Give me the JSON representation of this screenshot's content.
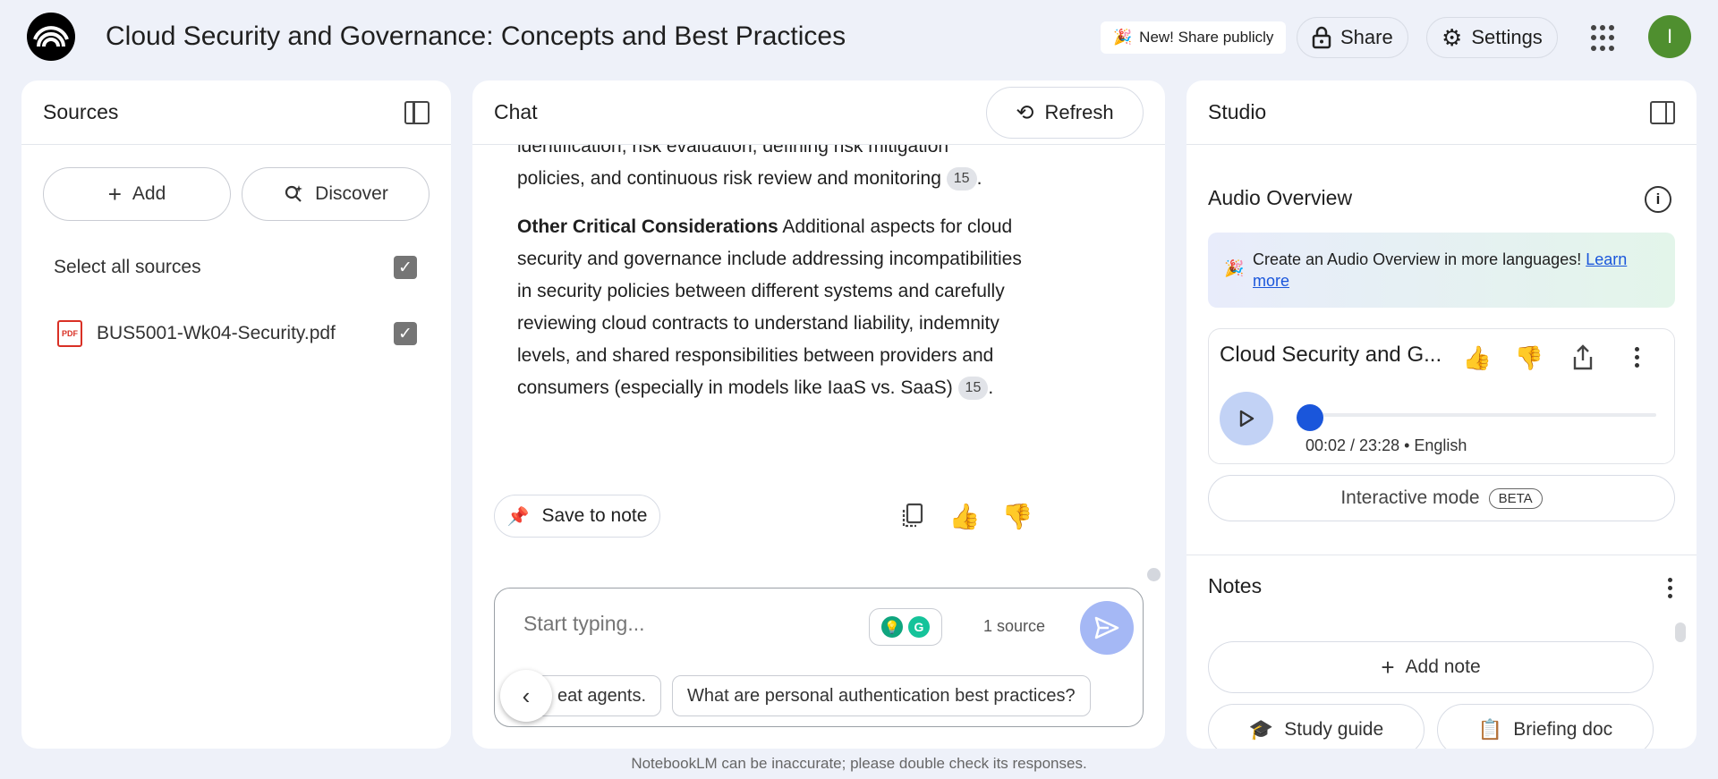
{
  "header": {
    "title": "Cloud Security and Governance: Concepts and Best Practices",
    "new_share_label": "New! Share publicly",
    "share_label": "Share",
    "settings_label": "Settings",
    "avatar_initial": "I"
  },
  "sources": {
    "title": "Sources",
    "add_label": "Add",
    "discover_label": "Discover",
    "select_all_label": "Select all sources",
    "files": [
      {
        "name": "BUS5001-Wk04-Security.pdf",
        "checked": true
      }
    ]
  },
  "chat": {
    "title": "Chat",
    "refresh_label": "Refresh",
    "partial_line": "identification, risk evaluation, defining risk mitigation",
    "prev_paragraph_end": "policies, and continuous risk review and monitoring",
    "prev_cite": "15",
    "bullet_heading": "Other Critical Considerations",
    "bullet_text": "Additional aspects for cloud security and governance include addressing incompatibilities in security policies between different systems and carefully reviewing cloud contracts to understand liability, indemnity levels, and shared responsibilities between providers and consumers (especially in models like IaaS vs. SaaS)",
    "bullet_cite": "15",
    "save_to_note_label": "Save to note",
    "input_placeholder": "Start typing...",
    "source_count": "1 source",
    "suggestions": [
      "eat agents.",
      "What are personal authentication best practices?"
    ]
  },
  "studio": {
    "title": "Studio",
    "audio_overview_title": "Audio Overview",
    "banner_text": "Create an Audio Overview in more languages!",
    "banner_link": "Learn more",
    "audio_title": "Cloud Security and G...",
    "audio_time": "00:02 / 23:28 • English",
    "audio_progress": 0.0014,
    "interactive_label": "Interactive mode",
    "beta_label": "BETA",
    "notes_title": "Notes",
    "add_note_label": "Add note",
    "study_guide_label": "Study guide",
    "briefing_doc_label": "Briefing doc"
  },
  "footer": {
    "disclaimer": "NotebookLM can be inaccurate; please double check its responses."
  },
  "colors": {
    "background": "#eef1f9",
    "accent": "#1a56db",
    "send_button": "#a5b8f5",
    "avatar": "#4f8f2f"
  }
}
